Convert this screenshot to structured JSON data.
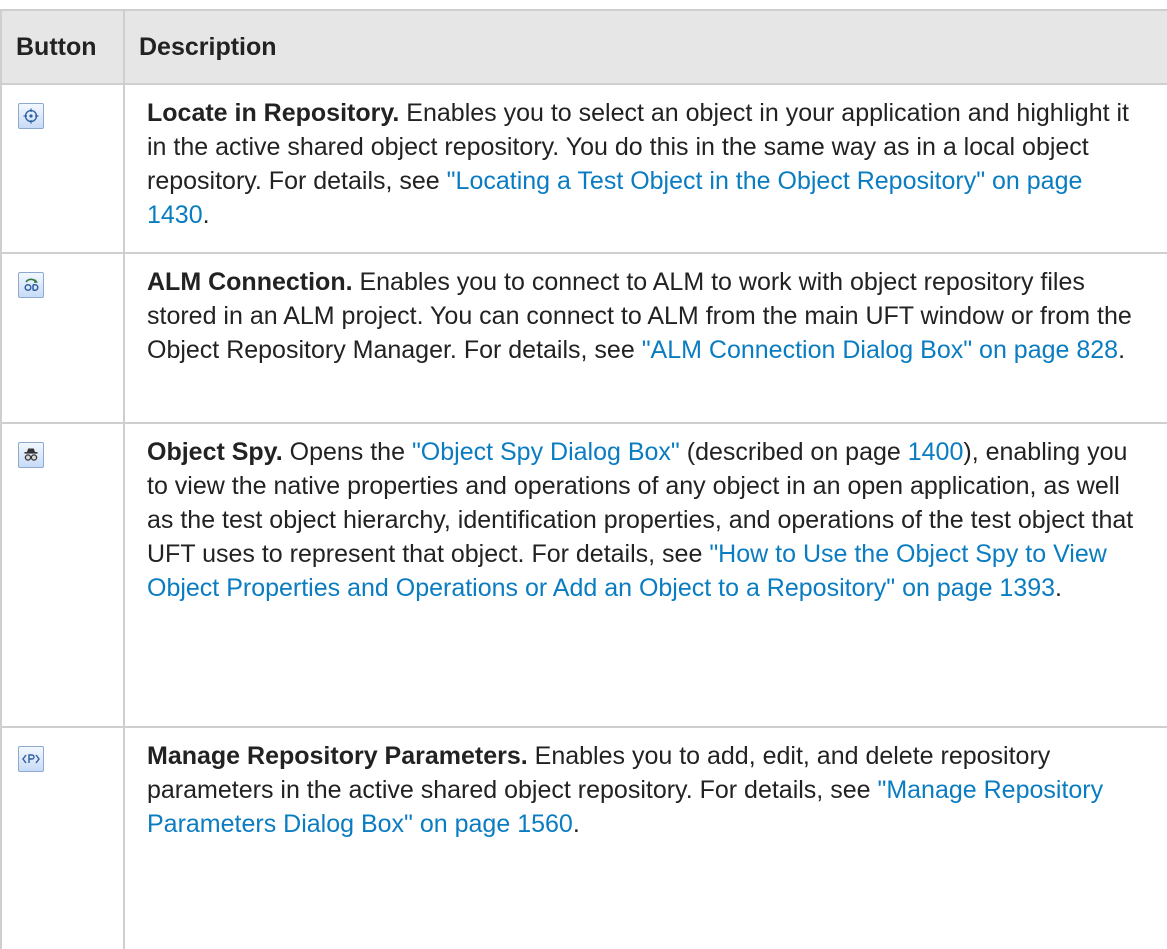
{
  "table": {
    "headers": [
      "Button",
      "Description"
    ],
    "rows": [
      {
        "icon": "locate-crosshair-icon",
        "term": "Locate in Repository.",
        "text_1": " Enables you to select an object in your application and highlight it in the active shared object repository. You do this in the same way as in a local object repository. For details, see ",
        "link_1": "\"Locating a Test Object in the Object Repository\" on page 1430",
        "text_2": "."
      },
      {
        "icon": "alm-connection-icon",
        "term": "ALM Connection.",
        "text_1": " Enables you to connect to ALM to work with object repository files stored in an ALM project. You can connect to ALM from the main UFT window or from the Object Repository Manager. For details, see ",
        "link_1": "\"ALM Connection Dialog Box\" on page 828",
        "text_2": "."
      },
      {
        "icon": "object-spy-icon",
        "term": "Object Spy.",
        "text_1": " Opens the ",
        "link_1": "\"Object Spy Dialog Box\"",
        "text_2": " (described on page ",
        "link_2": "1400",
        "text_3": "), enabling you to view the native properties and operations of any object in an open application, as well as the test object hierarchy, identification properties, and operations of the test object that UFT uses to represent that object. For details, see ",
        "link_3": "\"How to Use the Object Spy to View Object Properties and Operations or Add an Object to a Repository\" on page 1393",
        "text_4": "."
      },
      {
        "icon": "repository-parameters-icon",
        "term": "Manage Repository Parameters.",
        "text_1": " Enables you to add, edit, and delete repository parameters in the active shared object repository. For details, see ",
        "link_1": "\"Manage Repository Parameters Dialog Box\" on page 1560",
        "text_2": "."
      }
    ]
  },
  "colors": {
    "link": "#0a7cc1",
    "header_bg": "#e6e6e6",
    "border": "#cfcfcf"
  }
}
